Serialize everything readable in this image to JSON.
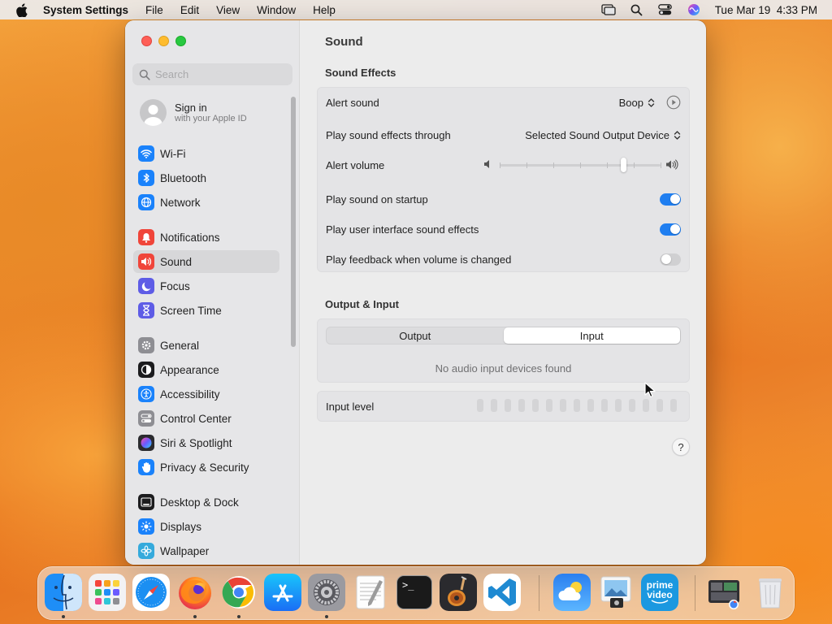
{
  "menubar": {
    "app_name": "System Settings",
    "menus": [
      "File",
      "Edit",
      "View",
      "Window",
      "Help"
    ],
    "clock": "Tue Mar 19  4:33 PM",
    "status_icons": [
      "screen-mirroring-icon",
      "spotlight-search-icon",
      "control-center-icon",
      "siri-icon"
    ]
  },
  "sidebar": {
    "search_placeholder": "Search",
    "signin": {
      "title": "Sign in",
      "subtitle": "with your Apple ID"
    },
    "items": [
      {
        "label": "Wi-Fi",
        "icon": "wifi-icon",
        "color": "#1a82fb"
      },
      {
        "label": "Bluetooth",
        "icon": "bluetooth-icon",
        "color": "#1a82fb"
      },
      {
        "label": "Network",
        "icon": "globe-icon",
        "color": "#1a82fb"
      },
      {
        "label": "Notifications",
        "icon": "bell-icon",
        "color": "#f0453a"
      },
      {
        "label": "Sound",
        "icon": "speaker-icon",
        "color": "#f0453a",
        "selected": true
      },
      {
        "label": "Focus",
        "icon": "moon-icon",
        "color": "#5e5ce6"
      },
      {
        "label": "Screen Time",
        "icon": "hourglass-icon",
        "color": "#5e5ce6"
      },
      {
        "label": "General",
        "icon": "gear-icon",
        "color": "#8e8e93"
      },
      {
        "label": "Appearance",
        "icon": "appearance-icon",
        "color": "#1c1c1e"
      },
      {
        "label": "Accessibility",
        "icon": "accessibility-icon",
        "color": "#1a82fb"
      },
      {
        "label": "Control Center",
        "icon": "control-center-icon",
        "color": "#8e8e93"
      },
      {
        "label": "Siri & Spotlight",
        "icon": "siri-icon",
        "color": "#2b2b2f"
      },
      {
        "label": "Privacy & Security",
        "icon": "hand-icon",
        "color": "#1a82fb"
      },
      {
        "label": "Desktop & Dock",
        "icon": "dock-icon",
        "color": "#1c1c1e"
      },
      {
        "label": "Displays",
        "icon": "sun-icon",
        "color": "#1a82fb"
      },
      {
        "label": "Wallpaper",
        "icon": "flower-icon",
        "color": "#35aadc"
      }
    ]
  },
  "content": {
    "title": "Sound",
    "sound_effects": {
      "heading": "Sound Effects",
      "alert_sound_label": "Alert sound",
      "alert_sound_value": "Boop",
      "play_through_label": "Play sound effects through",
      "play_through_value": "Selected Sound Output Device",
      "alert_volume_label": "Alert volume",
      "alert_volume_level": 0.77,
      "startup_label": "Play sound on startup",
      "startup_on": true,
      "ui_sounds_label": "Play user interface sound effects",
      "ui_sounds_on": true,
      "feedback_label": "Play feedback when volume is changed",
      "feedback_on": false
    },
    "output_input": {
      "heading": "Output & Input",
      "tabs": [
        "Output",
        "Input"
      ],
      "active_tab": "Input",
      "empty_message": "No audio input devices found",
      "input_level_label": "Input level",
      "input_level_value": 0
    },
    "help_label": "?"
  },
  "dock": {
    "apps": [
      {
        "name": "Finder",
        "icon": "finder-icon",
        "running": true
      },
      {
        "name": "Launchpad",
        "icon": "launchpad-icon",
        "running": false
      },
      {
        "name": "Safari",
        "icon": "safari-icon",
        "running": false
      },
      {
        "name": "Firefox",
        "icon": "firefox-icon",
        "running": true
      },
      {
        "name": "Chrome",
        "icon": "chrome-icon",
        "running": true
      },
      {
        "name": "App Store",
        "icon": "app-store-icon",
        "running": false
      },
      {
        "name": "System Settings",
        "icon": "system-settings-icon",
        "running": true
      },
      {
        "name": "TextEdit",
        "icon": "textedit-icon",
        "running": false
      },
      {
        "name": "Terminal",
        "icon": "terminal-icon",
        "running": false
      },
      {
        "name": "GarageBand",
        "icon": "garageband-icon",
        "running": false
      },
      {
        "name": "Visual Studio Code",
        "icon": "vscode-icon",
        "running": false
      },
      {
        "name": "Weather",
        "icon": "weather-icon",
        "running": false
      },
      {
        "name": "Preview",
        "icon": "preview-icon",
        "running": false
      },
      {
        "name": "Prime Video",
        "icon": "prime-video-icon",
        "running": false
      },
      {
        "name": "Downloads",
        "icon": "downloads-stack-icon",
        "running": false
      },
      {
        "name": "Trash",
        "icon": "trash-icon",
        "running": false
      }
    ],
    "terminal_prompt": ">_",
    "prime_label_1": "prime",
    "prime_label_2": "video"
  }
}
